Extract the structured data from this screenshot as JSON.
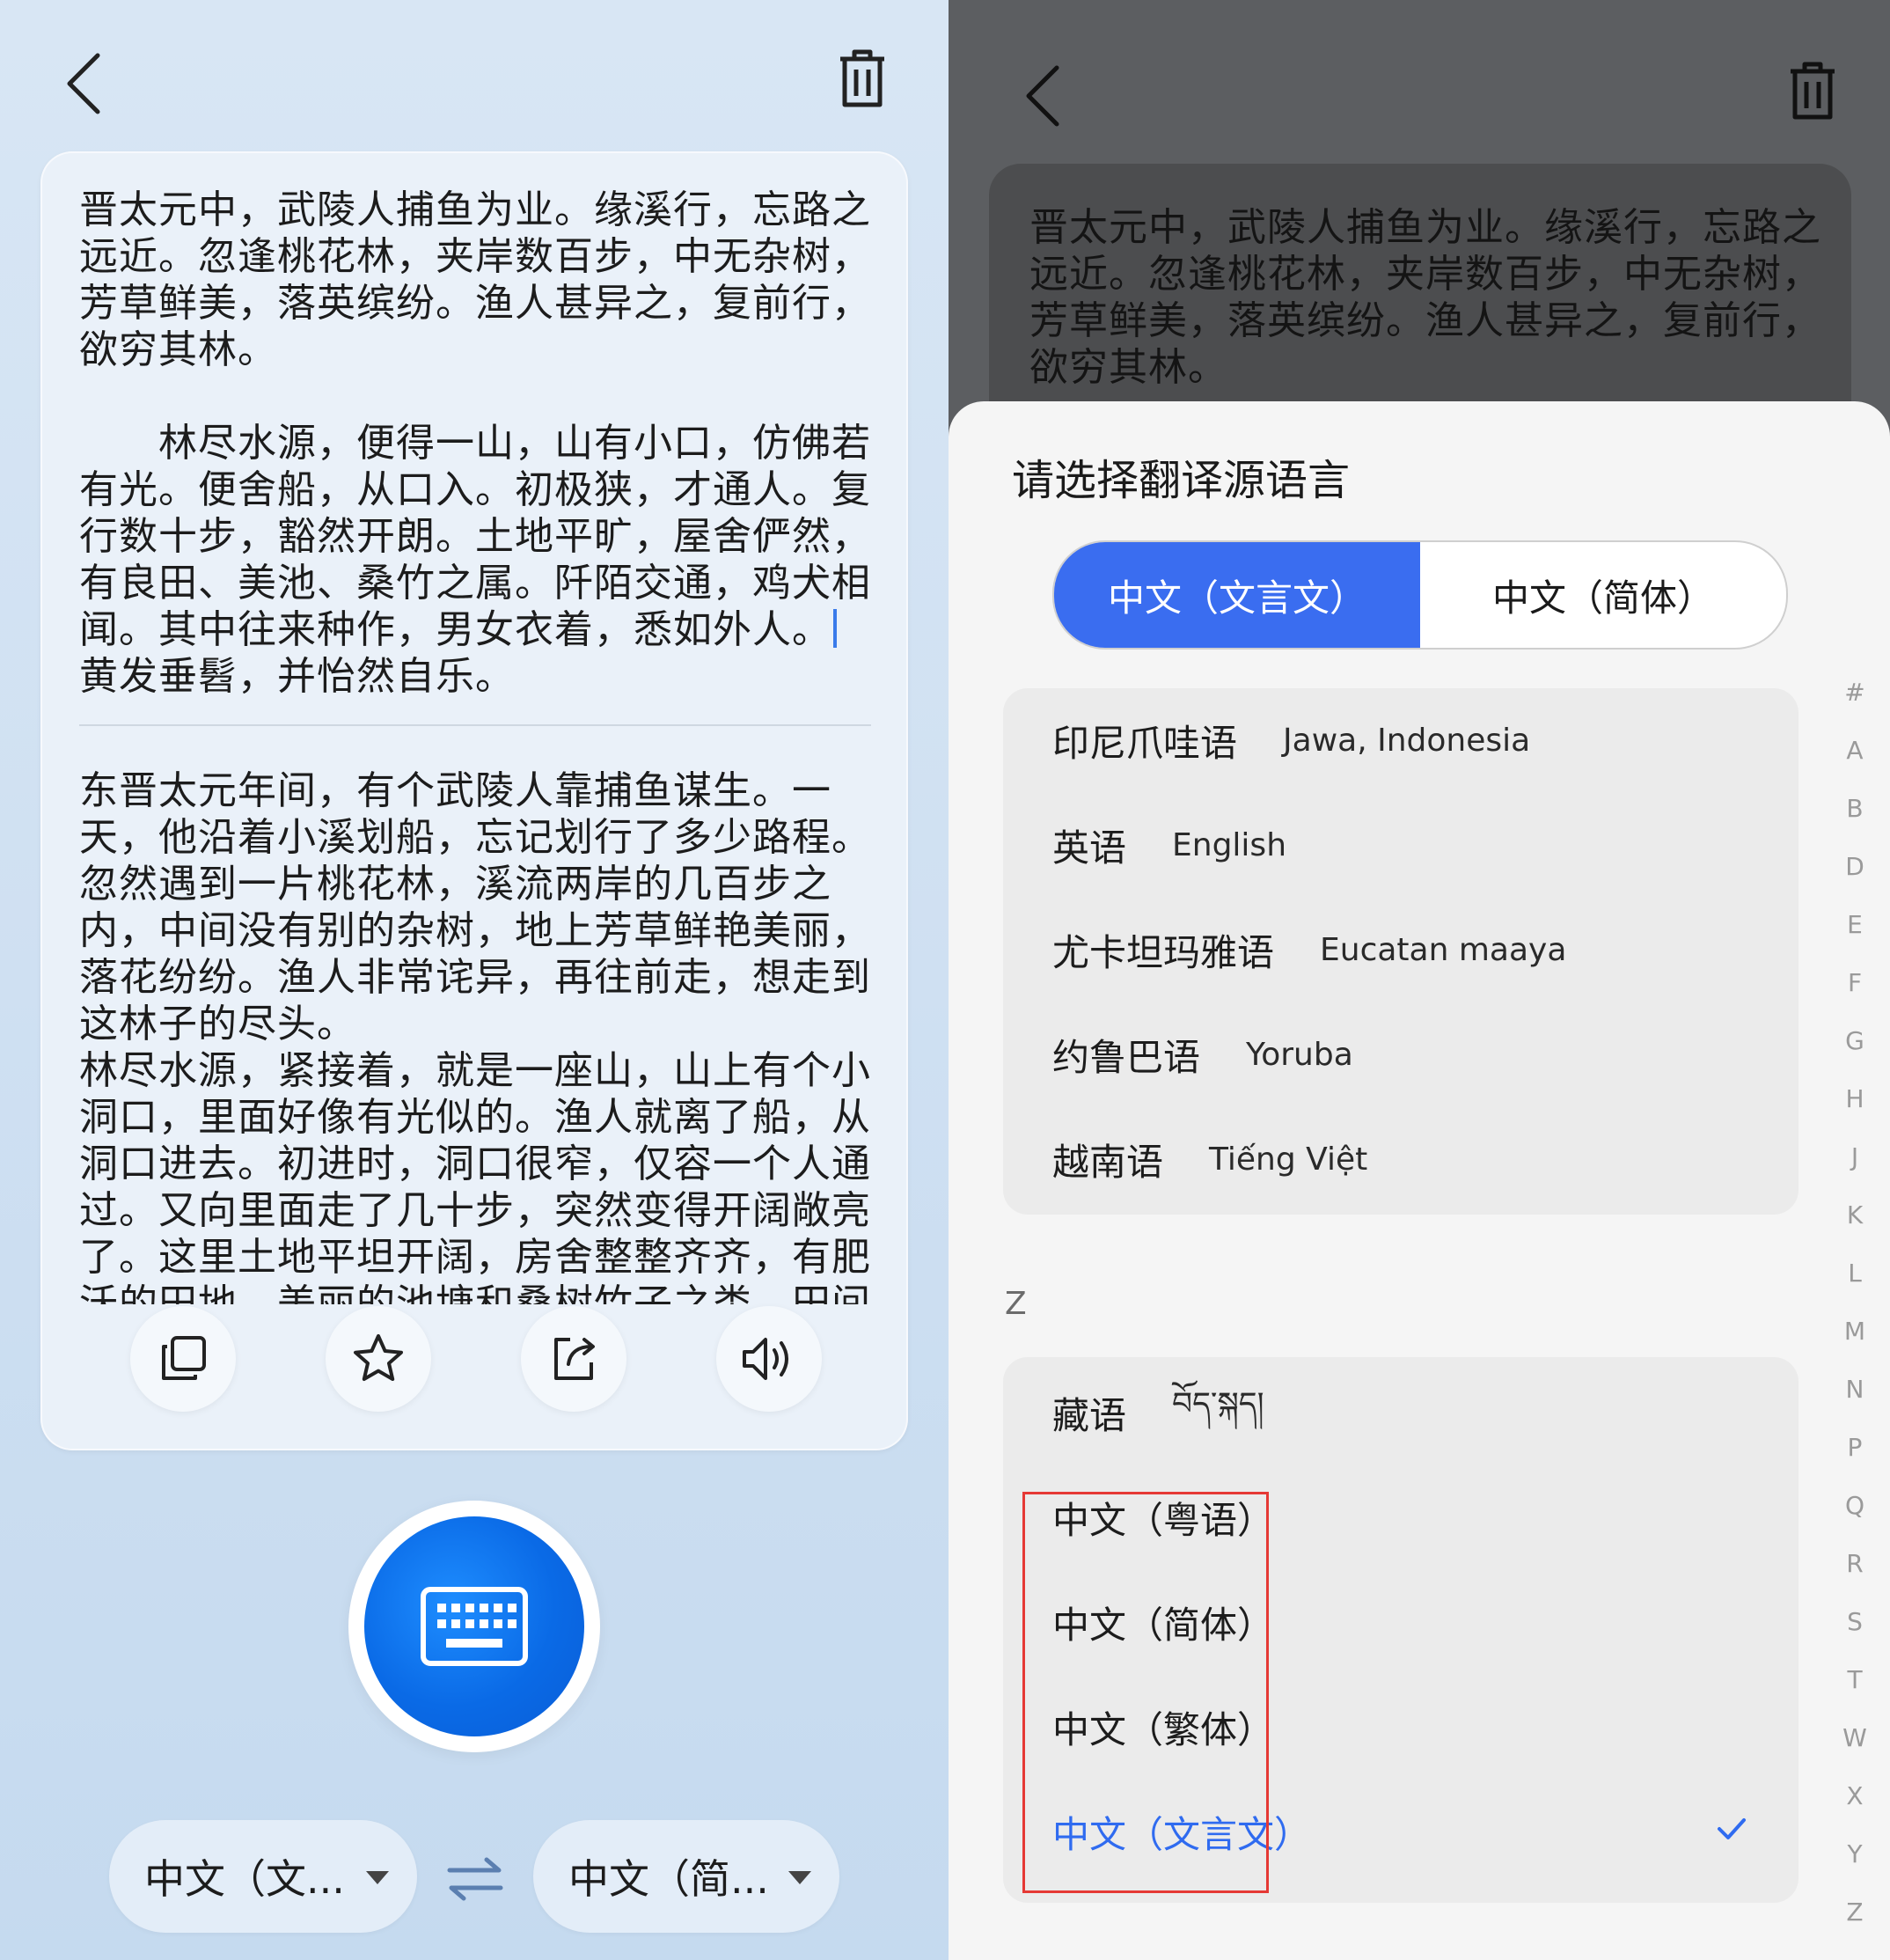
{
  "left": {
    "source_text": "晋太元中，武陵人捕鱼为业。缘溪行，忘路之远近。忽逢桃花林，夹岸数百步，中无杂树，芳草鲜美，落英缤纷。渔人甚异之，复前行，欲穷其林。\n\n　　林尽水源，便得一山，山有小口，仿佛若有光。便舍船，从口入。初极狭，才通人。复行数十步，豁然开朗。土地平旷，屋舍俨然，有良田、美池、桑竹之属。阡陌交通，鸡犬相闻。其中往来种作，男女衣着，悉如外人。",
    "source_text_after_caret": "黄发垂髫，并怡然自乐。",
    "translation_text": "东晋太元年间，有个武陵人靠捕鱼谋生。一天，他沿着小溪划船，忘记划行了多少路程。忽然遇到一片桃花林，溪流两岸的几百步之内，中间没有别的杂树，地上芳草鲜艳美丽，落花纷纷。渔人非常诧异，再往前走，想走到这林子的尽头。\n林尽水源，紧接着，就是一座山，山上有个小洞口，里面好像有光似的。渔人就离了船，从洞口进去。初进时，洞口很窄，仅容一个人通过。又向里面走了几十步，突然变得开阔敞亮了。这里土地平坦开阔，房舍整整齐齐，有肥沃的田地、美丽的池塘和桑树竹子之类。田间",
    "source_lang": "中文（文...",
    "target_lang": "中文（简..."
  },
  "right": {
    "dim_text": "晋太元中，武陵人捕鱼为业。缘溪行，忘路之远近。忽逢桃花林，夹岸数百步，中无杂树，芳草鲜美，落英缤纷。渔人甚异之，复前行，欲穷其林。",
    "sheet_title": "请选择翻译源语言",
    "tabs": [
      "中文（文言文）",
      "中文（简体）"
    ],
    "group1": [
      {
        "zh": "印尼爪哇语",
        "native": "Jawa, Indonesia"
      },
      {
        "zh": "英语",
        "native": "English"
      },
      {
        "zh": "尤卡坦玛雅语",
        "native": "Eucatan maaya"
      },
      {
        "zh": "约鲁巴语",
        "native": "Yoruba"
      },
      {
        "zh": "越南语",
        "native": "Tiếng Việt"
      }
    ],
    "section_z": "Z",
    "group2": [
      {
        "zh": "藏语",
        "native": "བོད་སྐད།"
      },
      {
        "zh": "中文（粤语）",
        "native": ""
      },
      {
        "zh": "中文（简体）",
        "native": ""
      },
      {
        "zh": "中文（繁体）",
        "native": ""
      },
      {
        "zh": "中文（文言文）",
        "native": ""
      }
    ],
    "selected_language": "中文（文言文）",
    "index_letters": [
      "#",
      "A",
      "B",
      "D",
      "E",
      "F",
      "G",
      "H",
      "J",
      "K",
      "L",
      "M",
      "N",
      "P",
      "Q",
      "R",
      "S",
      "T",
      "W",
      "X",
      "Y",
      "Z"
    ]
  },
  "colors": {
    "accent": "#3a6df0",
    "highlight_box": "#e53935",
    "mic": "#0a6ae6"
  },
  "icons": [
    "back-arrow-icon",
    "trash-icon",
    "copy-icon",
    "star-icon",
    "share-icon",
    "speaker-icon",
    "keyboard-icon",
    "swap-icon",
    "check-icon"
  ]
}
